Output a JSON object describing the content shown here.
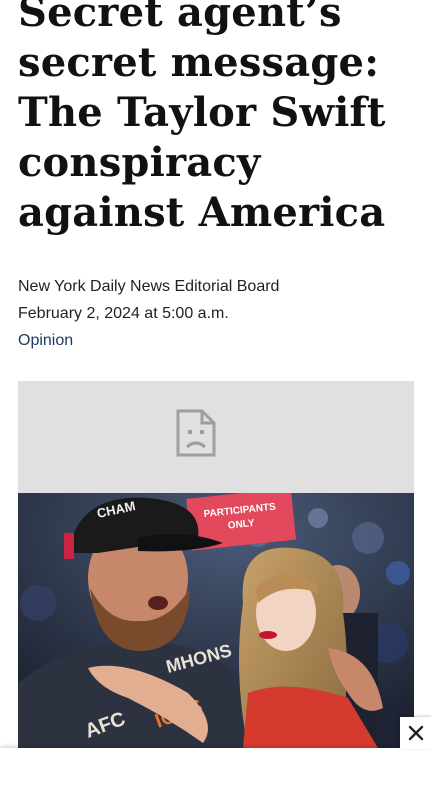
{
  "article": {
    "headline": "Secret agent’s secret message: The Taylor Swift conspiracy against America",
    "byline": "New York Daily News Editorial Board",
    "date": "February 2, 2024 at 5:00 a.m.",
    "section": "Opinion"
  },
  "photo": {
    "cap_text": "CHAM",
    "sign_text_line1": "PARTICIPANTS",
    "sign_text_line2": "ONLY",
    "shirt_text_line1": "MHONS",
    "shirt_text_line2": "AFC",
    "shirt_text_line3": "IONS"
  },
  "icons": {
    "broken_image": "broken-image-icon",
    "close": "close-icon"
  },
  "colors": {
    "link": "#1f3a5f",
    "placeholder": "#e0e0e0"
  }
}
